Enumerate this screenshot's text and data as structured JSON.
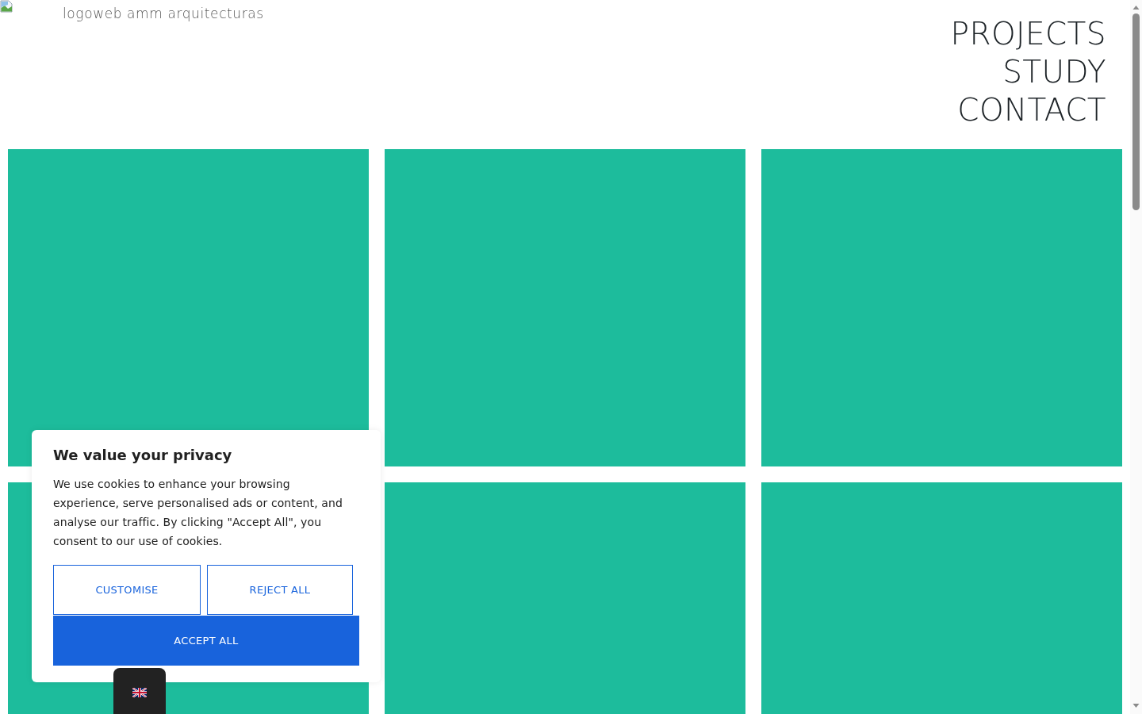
{
  "logo": {
    "alt_text": "logoweb amm arquitecturas"
  },
  "nav": [
    {
      "label": "PROJECTS"
    },
    {
      "label": "STUDY"
    },
    {
      "label": "CONTACT"
    }
  ],
  "cookie_banner": {
    "title": "We value your privacy",
    "text": "We use cookies to enhance your browsing experience, serve personalised ads or content, and analyse our traffic. By clicking \"Accept All\", you consent to our use of cookies.",
    "buttons": [
      {
        "label": "CUSTOMISE",
        "kind": "outline"
      },
      {
        "label": "REJECT ALL",
        "kind": "outline"
      },
      {
        "label": "ACCEPT ALL",
        "kind": "primary"
      }
    ]
  }
}
